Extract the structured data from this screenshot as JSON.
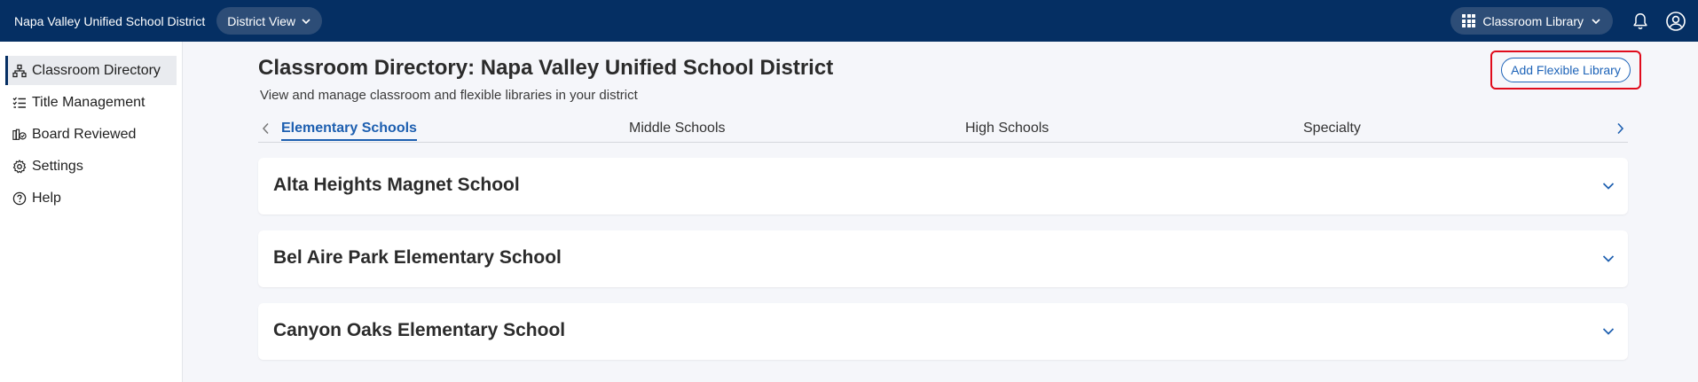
{
  "topbar": {
    "district_name": "Napa Valley Unified School District",
    "view_selector": "District View",
    "app_switcher": "Classroom Library",
    "icons": [
      "grid-icon",
      "chevron-down-icon",
      "bell-icon",
      "user-circle-icon"
    ]
  },
  "sidebar": {
    "items": [
      {
        "label": "Classroom Directory",
        "icon": "hierarchy-icon",
        "active": true
      },
      {
        "label": "Title Management",
        "icon": "checklist-icon",
        "active": false
      },
      {
        "label": "Board Reviewed",
        "icon": "books-check-icon",
        "active": false
      },
      {
        "label": "Settings",
        "icon": "gear-icon",
        "active": false
      },
      {
        "label": "Help",
        "icon": "question-circle-icon",
        "active": false
      }
    ]
  },
  "main": {
    "title": "Classroom Directory: Napa Valley Unified School District",
    "subtitle": "View and manage classroom and flexible libraries in your district",
    "add_button": "Add Flexible Library",
    "tabs": [
      {
        "label": "Elementary Schools",
        "active": true
      },
      {
        "label": "Middle Schools",
        "active": false
      },
      {
        "label": "High Schools",
        "active": false
      },
      {
        "label": "Specialty",
        "active": false
      }
    ],
    "schools": [
      {
        "name": "Alta Heights Magnet School"
      },
      {
        "name": "Bel Aire Park Elementary School"
      },
      {
        "name": "Canyon Oaks Elementary School"
      }
    ]
  },
  "colors": {
    "topbar": "#052f63",
    "pill": "#2d4d77",
    "accent": "#1d5fb0",
    "highlight_border": "#e00b1c",
    "background": "#f5f6fa"
  }
}
